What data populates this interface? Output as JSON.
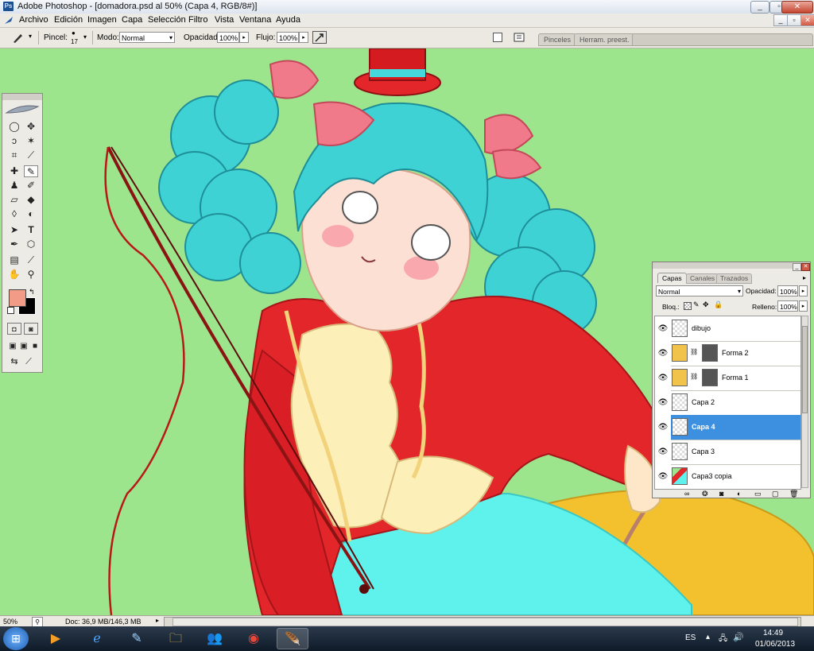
{
  "app": {
    "title": "Adobe Photoshop - [domadora.psd al 50% (Capa 4, RGB/8#)]",
    "icon_label": "Ps"
  },
  "window_controls": {
    "minimize": "_",
    "restore": "▫",
    "close": "✕"
  },
  "menu": {
    "items": [
      "Archivo",
      "Edición",
      "Imagen",
      "Capa",
      "Selección",
      "Filtro",
      "Vista",
      "Ventana",
      "Ayuda"
    ]
  },
  "options": {
    "brush_label": "Pincel:",
    "brush_size": "17",
    "mode_label": "Modo:",
    "mode_value": "Normal",
    "opacity_label": "Opacidad:",
    "opacity_value": "100%",
    "flow_label": "Flujo:",
    "flow_value": "100%",
    "tab_brushes": "Pinceles",
    "tab_presets": "Herram. preest."
  },
  "layers_panel": {
    "tabs": [
      "Capas",
      "Canales",
      "Trazados"
    ],
    "blend_mode": "Normal",
    "opacity_label": "Opacidad:",
    "opacity_value": "100%",
    "lock_label": "Bloq.:",
    "fill_label": "Relleno:",
    "fill_value": "100%",
    "layers": [
      {
        "name": "dibujo",
        "thumb": "transparent",
        "selected": false
      },
      {
        "name": "Forma 2",
        "thumb": "orange",
        "selected": false
      },
      {
        "name": "Forma 1",
        "thumb": "orange",
        "selected": false
      },
      {
        "name": "Capa 2",
        "thumb": "transparent",
        "selected": false
      },
      {
        "name": "Capa 4",
        "thumb": "transparent",
        "selected": true
      },
      {
        "name": "Capa 3",
        "thumb": "transparent",
        "selected": false
      },
      {
        "name": "Capa3 copia",
        "thumb": "art",
        "selected": false
      }
    ]
  },
  "status": {
    "zoom": "50%",
    "doc": "Doc: 36,9 MB/146,3 MB"
  },
  "taskbar": {
    "language": "ES",
    "time": "14:49",
    "date": "01/06/2013"
  },
  "colors": {
    "canvas_bg": "#9de58c",
    "foreground": "#f29b86",
    "background": "#000000",
    "selected_layer": "#3d8fe0"
  }
}
